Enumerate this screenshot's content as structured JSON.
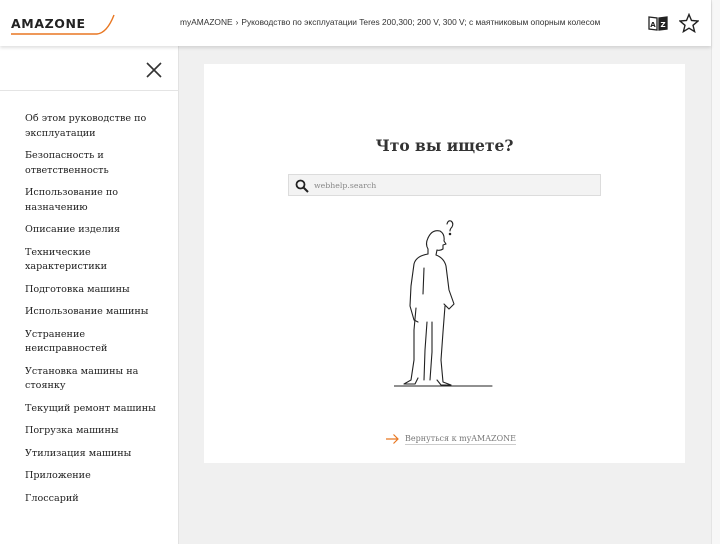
{
  "header": {
    "logo_text": "AMAZONE",
    "breadcrumb": {
      "root": "myAMAZONE",
      "separator": "›",
      "current": "Руководство по эксплуатации Teres 200,300; 200 V, 300 V; с маятниковым опорным колесом"
    },
    "icons": [
      "translate-icon",
      "star-icon"
    ]
  },
  "sidebar": {
    "items": [
      {
        "label": "Об этом руководстве по эксплуатации"
      },
      {
        "label": "Безопасность и ответственность"
      },
      {
        "label": "Использование по назначению"
      },
      {
        "label": "Описание изделия"
      },
      {
        "label": "Технические характеристики"
      },
      {
        "label": "Подготовка машины"
      },
      {
        "label": "Использование машины"
      },
      {
        "label": "Устранение неисправностей"
      },
      {
        "label": "Установка машины на стоянку"
      },
      {
        "label": "Текущий ремонт машины"
      },
      {
        "label": "Погрузка машины"
      },
      {
        "label": "Утилизация машины"
      },
      {
        "label": "Приложение"
      },
      {
        "label": "Глоссарий"
      }
    ]
  },
  "main": {
    "title": "Что вы ищете?",
    "search": {
      "placeholder": "webhelp.search",
      "value": ""
    },
    "back_link": "Вернуться к myAMAZONE"
  },
  "colors": {
    "accent": "#e87722",
    "text": "#222222",
    "background": "#f0f0f0"
  }
}
